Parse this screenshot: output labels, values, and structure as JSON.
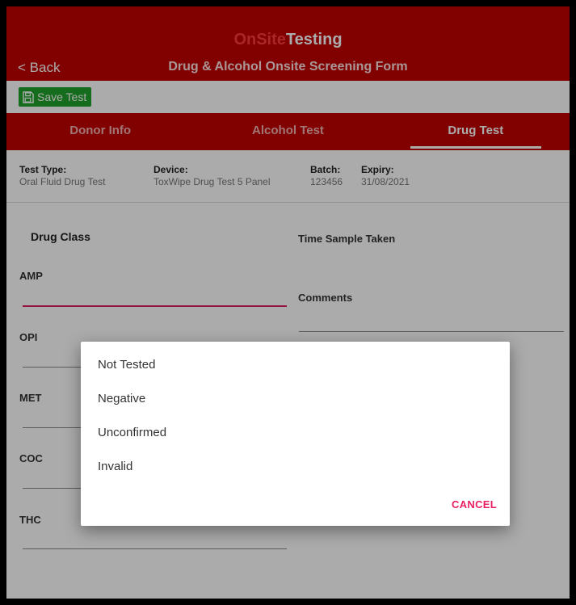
{
  "header": {
    "brand_on": "On",
    "brand_site": "Site",
    "brand_testing": "Testing",
    "back_label": "< Back",
    "form_title": "Drug & Alcohol Onsite Screening Form"
  },
  "toolbar": {
    "save_label": "Save Test",
    "save_icon": "save-icon"
  },
  "tabs": [
    {
      "label": "Donor Info",
      "active": false
    },
    {
      "label": "Alcohol Test",
      "active": false
    },
    {
      "label": "Drug Test",
      "active": true
    }
  ],
  "info": {
    "test_type_label": "Test Type:",
    "test_type_value": "Oral Fluid Drug Test",
    "device_label": "Device:",
    "device_value": "ToxWipe Drug Test 5 Panel",
    "batch_label": "Batch:",
    "batch_value": "123456",
    "expiry_label": "Expiry:",
    "expiry_value": "31/08/2021"
  },
  "form": {
    "drug_class_heading": "Drug Class",
    "drug_classes": [
      "AMP",
      "OPI",
      "MET",
      "COC",
      "THC"
    ],
    "time_sample_label": "Time Sample Taken",
    "comments_label": "Comments"
  },
  "dialog": {
    "options": [
      "Not Tested",
      "Negative",
      "Unconfirmed",
      "Invalid"
    ],
    "cancel_label": "CANCEL"
  },
  "colors": {
    "brand_red": "#c00000",
    "save_green": "#1fa12a",
    "accent_pink": "#e91e63"
  }
}
